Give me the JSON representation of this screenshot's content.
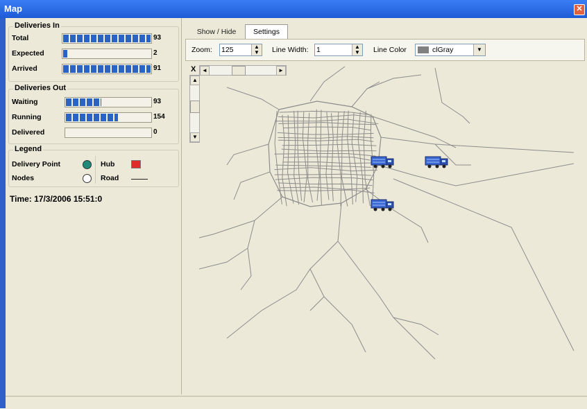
{
  "window": {
    "title": "Map",
    "close_icon": "close-icon"
  },
  "deliveries_in": {
    "title": "Deliveries In",
    "rows": [
      {
        "label": "Total",
        "value": "93",
        "fill": 1.0
      },
      {
        "label": "Expected",
        "value": "2",
        "fill": 0.06
      },
      {
        "label": "Arrived",
        "value": "91",
        "fill": 1.0
      }
    ]
  },
  "deliveries_out": {
    "title": "Deliveries Out",
    "rows": [
      {
        "label": "Waiting",
        "value": "93",
        "fill": 0.43
      },
      {
        "label": "Running",
        "value": "154",
        "fill": 0.62
      },
      {
        "label": "Delivered",
        "value": "0",
        "fill": 0.0
      }
    ]
  },
  "legend": {
    "title": "Legend",
    "items": [
      {
        "label": "Delivery Point",
        "icon": "delivery-point-icon",
        "color": "#1f8a7a"
      },
      {
        "label": "Hub",
        "icon": "hub-icon",
        "color": "#e02b2b"
      },
      {
        "label": "Nodes",
        "icon": "node-icon",
        "color": "#ffffff"
      },
      {
        "label": "Road",
        "icon": "road-icon",
        "color": "#222222"
      }
    ]
  },
  "time": "Time: 17/3/2006 15:51:0",
  "tabs": [
    {
      "label": "Show / Hide",
      "active": false
    },
    {
      "label": "Settings",
      "active": true
    }
  ],
  "settings": {
    "zoom_label": "Zoom:",
    "zoom_value": "125",
    "line_width_label": "Line Width:",
    "line_width_value": "1",
    "line_color_label": "Line Color",
    "line_color_value": "clGray",
    "line_color_hex": "#808080"
  },
  "map": {
    "road_color": "#8c8c8c",
    "truck_icon": "truck-icon",
    "truck_count": 3
  }
}
